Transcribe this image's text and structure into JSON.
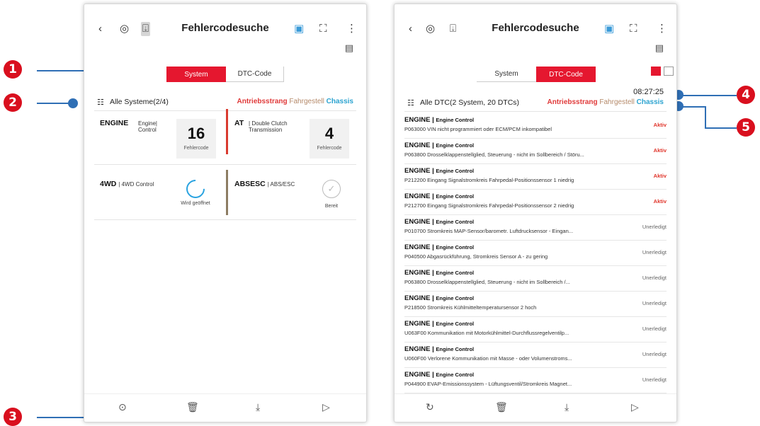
{
  "callouts": [
    "1",
    "2",
    "3",
    "4",
    "5"
  ],
  "left": {
    "title": "Fehlercodesuche",
    "icons": {
      "back": "chevron-left-icon",
      "scan": "vehicle-scan-icon",
      "export": "export-icon",
      "camera": "camera-icon",
      "screenshot": "screenshot-icon",
      "more": "more-icon",
      "report": "report-icon"
    },
    "seg": {
      "system": "System",
      "dtc": "DTC-Code"
    },
    "filter_label": "Alle Systeme(2/4)",
    "filters": [
      "Antriebsstrang",
      "Fahrgestell",
      "Chassis"
    ],
    "systems": [
      {
        "name": "ENGINE",
        "desc1": "Engine",
        "desc2": "Control",
        "count": "16",
        "count_label": "Fehlercode",
        "bar_color": "#ffffff"
      },
      {
        "name": "AT",
        "desc1": "Double Clutch",
        "desc2": "Transmission",
        "count": "4",
        "count_label": "Fehlercode",
        "bar_color": "#d93a2f"
      },
      {
        "name": "4WD",
        "desc1": "4WD Control",
        "desc2": "",
        "state": "Wird geöffnet",
        "bar_color": "#ffffff"
      },
      {
        "name": "ABSESC",
        "desc1": "ABS/ESC",
        "desc2": "",
        "state": "Bereit",
        "bar_color": "#8d7d63"
      }
    ]
  },
  "right": {
    "title": "Fehlercodesuche",
    "seg": {
      "system": "System",
      "dtc": "DTC-Code"
    },
    "time": "08:27:25",
    "filter_label": "Alle DTC(2 System, 20 DTCs)",
    "filters": [
      "Antriebsstrang",
      "Fahrgestell",
      "Chassis"
    ],
    "dtcs": [
      {
        "sys": "ENGINE",
        "sub": "Engine Control",
        "desc": "P063000 VIN nicht programmiert oder ECM/PCM inkompatibel",
        "status": "Aktiv",
        "active": true
      },
      {
        "sys": "ENGINE",
        "sub": "Engine Control",
        "desc": "P063800 Drosselklappenstellglied, Steuerung - nicht im Sollbereich / Störu...",
        "status": "Aktiv",
        "active": true
      },
      {
        "sys": "ENGINE",
        "sub": "Engine Control",
        "desc": "P212200 Eingang Signalstromkreis Fahrpedal-Positionssensor 1 niedrig",
        "status": "Aktiv",
        "active": true
      },
      {
        "sys": "ENGINE",
        "sub": "Engine Control",
        "desc": "P212700 Eingang Signalstromkreis Fahrpedal-Positionssensor 2 niedrig",
        "status": "Aktiv",
        "active": true
      },
      {
        "sys": "ENGINE",
        "sub": "Engine Control",
        "desc": "P010700 Stromkreis MAP-Sensor/barometr. Luftdrucksensor - Eingan...",
        "status": "Unerledigt",
        "active": false
      },
      {
        "sys": "ENGINE",
        "sub": "Engine Control",
        "desc": "P040500 Abgasrückführung, Stromkreis Sensor A - zu gering",
        "status": "Unerledigt",
        "active": false
      },
      {
        "sys": "ENGINE",
        "sub": "Engine Control",
        "desc": "P063800 Drosselklappenstellglied, Steuerung - nicht im Sollbereich /...",
        "status": "Unerledigt",
        "active": false
      },
      {
        "sys": "ENGINE",
        "sub": "Engine Control",
        "desc": "P218500 Stromkreis Kühlmitteltemperatursensor 2 hoch",
        "status": "Unerledigt",
        "active": false
      },
      {
        "sys": "ENGINE",
        "sub": "Engine Control",
        "desc": "U063F00 Kommunikation mit Motorkühlmittel-Durchflussregelventilp...",
        "status": "Unerledigt",
        "active": false
      },
      {
        "sys": "ENGINE",
        "sub": "Engine Control",
        "desc": "U060F00 Verlorene Kommunikation mit Masse - oder Volumenstroms...",
        "status": "Unerledigt",
        "active": false
      },
      {
        "sys": "ENGINE",
        "sub": "Engine Control",
        "desc": "P044900 EVAP-Emissionssystem - Lüftungsventil/Stromkreis Magnet...",
        "status": "Unerledigt",
        "active": false
      }
    ]
  },
  "colors": {
    "accent": "#e5172f",
    "callout": "#d90f1e",
    "leader": "#2f6fb5",
    "chassis": "#2ca3d0"
  }
}
